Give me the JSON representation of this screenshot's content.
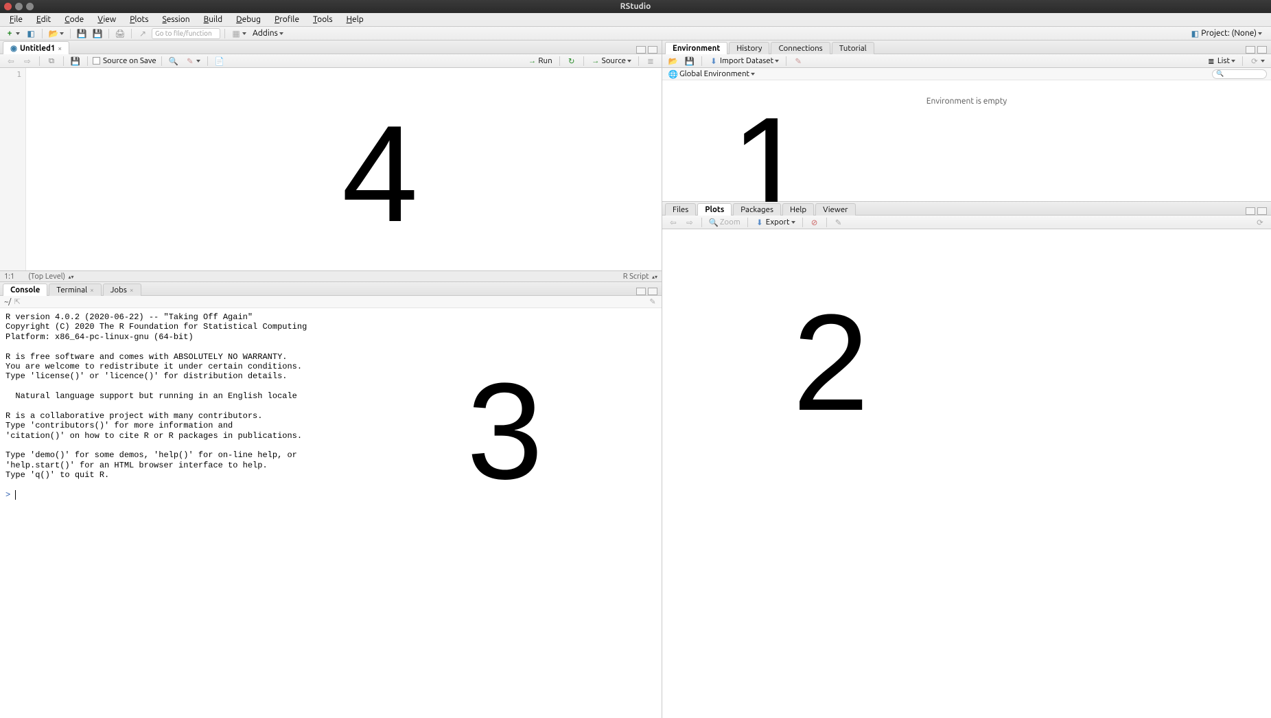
{
  "window": {
    "title": "RStudio"
  },
  "menubar": [
    "File",
    "Edit",
    "Code",
    "View",
    "Plots",
    "Session",
    "Build",
    "Debug",
    "Profile",
    "Tools",
    "Help"
  ],
  "toolbar": {
    "goto_placeholder": "Go to file/function",
    "addins": "Addins",
    "project_label": "Project: (None)"
  },
  "source": {
    "tab_title": "Untitled1",
    "source_on_save": "Source on Save",
    "run": "Run",
    "source_btn": "Source",
    "line_numbers": [
      "1"
    ],
    "status_pos": "1:1",
    "status_scope": "(Top Level)",
    "status_type": "R Script"
  },
  "console": {
    "tabs": [
      "Console",
      "Terminal",
      "Jobs"
    ],
    "path": "~/",
    "text": "R version 4.0.2 (2020-06-22) -- \"Taking Off Again\"\nCopyright (C) 2020 The R Foundation for Statistical Computing\nPlatform: x86_64-pc-linux-gnu (64-bit)\n\nR is free software and comes with ABSOLUTELY NO WARRANTY.\nYou are welcome to redistribute it under certain conditions.\nType 'license()' or 'licence()' for distribution details.\n\n  Natural language support but running in an English locale\n\nR is a collaborative project with many contributors.\nType 'contributors()' for more information and\n'citation()' on how to cite R or R packages in publications.\n\nType 'demo()' for some demos, 'help()' for on-line help, or\n'help.start()' for an HTML browser interface to help.\nType 'q()' to quit R.\n",
    "prompt": ">"
  },
  "environment": {
    "tabs": [
      "Environment",
      "History",
      "Connections",
      "Tutorial"
    ],
    "import": "Import Dataset",
    "scope": "Global Environment",
    "list": "List",
    "empty_msg": "Environment is empty"
  },
  "plots": {
    "tabs": [
      "Files",
      "Plots",
      "Packages",
      "Help",
      "Viewer"
    ],
    "zoom": "Zoom",
    "export": "Export"
  },
  "overlay": {
    "n1": "1",
    "n2": "2",
    "n3": "3",
    "n4": "4"
  }
}
